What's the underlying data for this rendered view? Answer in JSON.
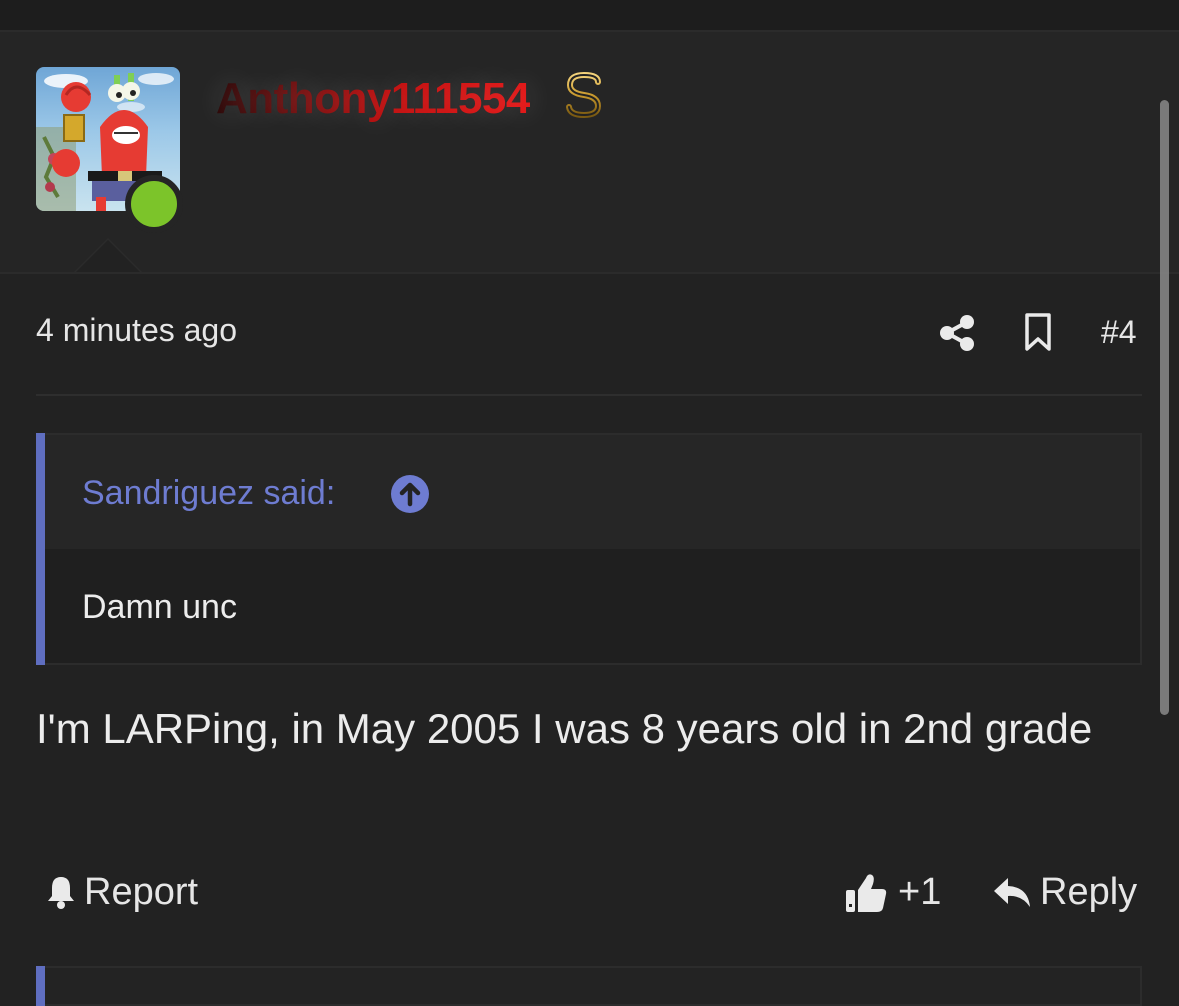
{
  "post": {
    "author": "Anthony111554",
    "author_badge_icon": "dollar-sign-icon",
    "author_online": true,
    "timestamp": "4 minutes ago",
    "post_number": "#4",
    "quote": {
      "author_line": "Sandriguez said:",
      "text": "Damn unc"
    },
    "message": "I'm LARPing, in May 2005 I was 8 years old in 2nd grade",
    "actions": {
      "report_label": "Report",
      "like_count": "+1",
      "reply_label": "Reply"
    }
  },
  "colors": {
    "background": "#222222",
    "quote_accent": "#5f6ec0",
    "quote_author": "#6e7cd1",
    "online_indicator": "#7cc42a",
    "username_gradient_start": "#2a0505",
    "username_gradient_end": "#e21414",
    "badge_gold": "#c99a2e"
  }
}
